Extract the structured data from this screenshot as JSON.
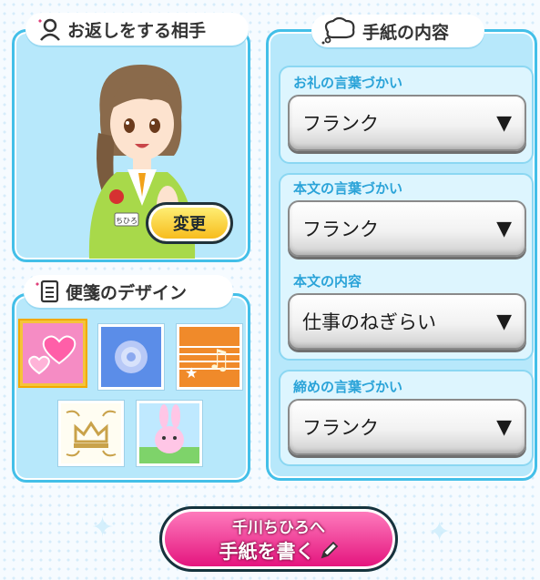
{
  "recipient_panel": {
    "title": "お返しをする相手",
    "change_button": "変更",
    "badge_text": "ちひろ"
  },
  "stationery_panel": {
    "title": "便箋のデザイン",
    "designs": [
      {
        "name": "heart",
        "selected": true
      },
      {
        "name": "rose",
        "selected": false
      },
      {
        "name": "music",
        "selected": false
      },
      {
        "name": "crown",
        "selected": false
      },
      {
        "name": "bunny",
        "selected": false
      }
    ]
  },
  "content_panel": {
    "title": "手紙の内容",
    "thanks_label": "お礼の言葉づかい",
    "thanks_value": "フランク",
    "body_label": "本文の言葉づかい",
    "body_value": "フランク",
    "body_content_label": "本文の内容",
    "body_content_value": "仕事のねぎらい",
    "closing_label": "締めの言葉づかい",
    "closing_value": "フランク",
    "dropdown_arrow": "▼"
  },
  "write_button": {
    "line1": "千川ちひろへ",
    "line2": "手紙を書く"
  },
  "colors": {
    "panel_bg": "#b7e8fb",
    "panel_border": "#43bfe8",
    "field_label": "#2aa3d8",
    "change_button": "#f6b816",
    "write_button": "#e3107b"
  }
}
